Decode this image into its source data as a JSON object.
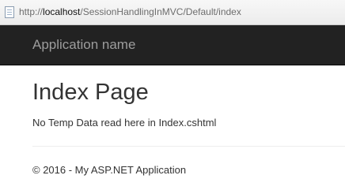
{
  "browser": {
    "url_scheme": "http://",
    "url_host": "localhost",
    "url_path": "/SessionHandlingInMVC/Default/index",
    "page_icon": "page-icon"
  },
  "navbar": {
    "brand": "Application name"
  },
  "main": {
    "title": "Index Page",
    "message": "No Temp Data read here in Index.cshtml"
  },
  "footer": {
    "text": "© 2016 - My ASP.NET Application"
  }
}
